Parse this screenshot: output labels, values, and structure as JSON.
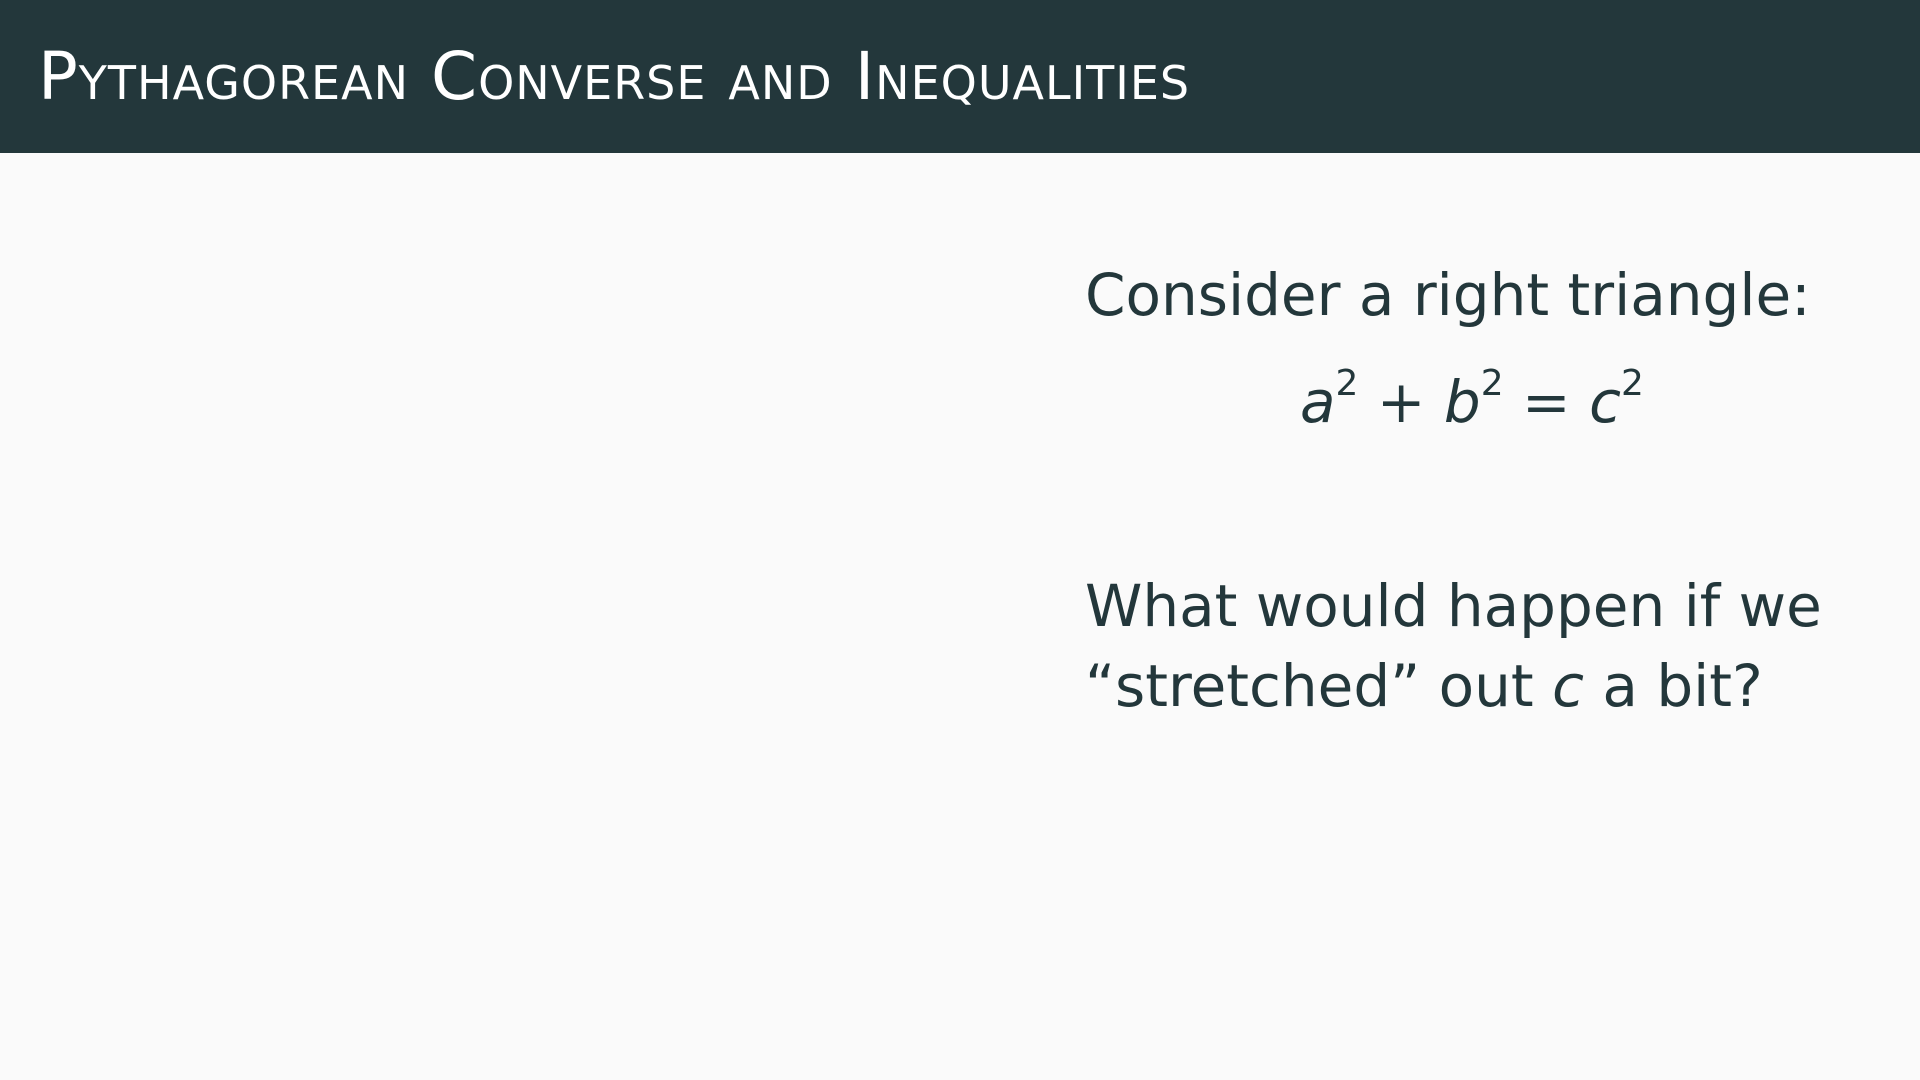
{
  "title": "Pythagorean Converse and Inequalities",
  "intro": "Consider a right triangle:",
  "equation": {
    "a": "a",
    "b": "b",
    "c": "c",
    "exp": "2",
    "plus": "+",
    "equals": "="
  },
  "question": {
    "line1": "What would happen if we",
    "line2_before": "“stretched” out ",
    "line2_var": "c",
    "line2_after": " a bit?"
  },
  "colors": {
    "title_bar": "#23373b",
    "background": "#fafafa",
    "text": "#23373b"
  }
}
